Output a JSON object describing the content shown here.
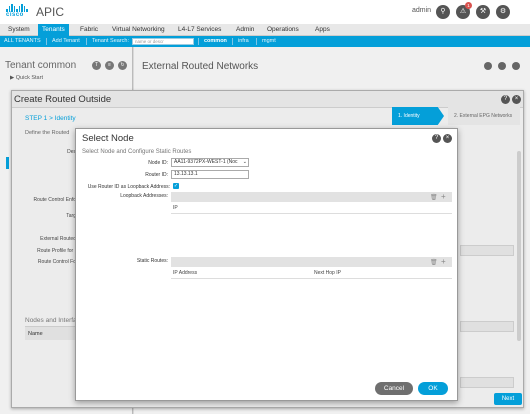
{
  "header": {
    "app_title": "APIC",
    "logo_text": "cisco",
    "user": "admin"
  },
  "nav": {
    "items": [
      "System",
      "Tenants",
      "Fabric",
      "Virtual Networking",
      "L4-L7 Services",
      "Admin",
      "Operations",
      "Apps"
    ],
    "active": "Tenants"
  },
  "subnav": {
    "all_tenants": "ALL TENANTS",
    "add_tenant": "Add Tenant",
    "tenant_search_label": "Tenant Search:",
    "tenant_search_placeholder": "name or descr",
    "common": "common",
    "infra": "infra",
    "mgmt": "mgmt"
  },
  "left_panel": {
    "title": "Tenant common",
    "quick_start": "Quick Start"
  },
  "right_panel": {
    "title": "External Routed Networks"
  },
  "create_routed_outside": {
    "title": "Create Routed Outside",
    "step": "STEP 1 > Identity",
    "wizard_step1": "1. Identity",
    "wizard_step2": "2. External EPG Networks",
    "define": "Define the Routed",
    "labels": {
      "des": "Des",
      "route_control_enfo": "Route Control Enfo",
      "targ": "Targ",
      "external_routed": "External Routed",
      "route_profile_for": "Route Profile for I",
      "route_control_fo": "Route Control Fo"
    },
    "nodes_and_interfaces": "Nodes and Interfac",
    "name_col": "Name",
    "next": "Next"
  },
  "select_node": {
    "title": "Select Node",
    "subtitle": "Select Node and Configure Static Routes",
    "node_id_label": "Node ID:",
    "node_id_value": "AA11-9372PX-WEST-1 (Noc",
    "router_id_label": "Router ID:",
    "router_id_value": "13.13.13.1",
    "use_router_id_label": "Use Router ID as Loopback Address:",
    "loopback_label": "Loopback Addresses:",
    "loopback_col": "IP",
    "static_routes_label": "Static Routes:",
    "static_col_ip": "IP Address",
    "static_col_nexthop": "Next Hop IP",
    "cancel": "Cancel",
    "ok": "OK"
  }
}
